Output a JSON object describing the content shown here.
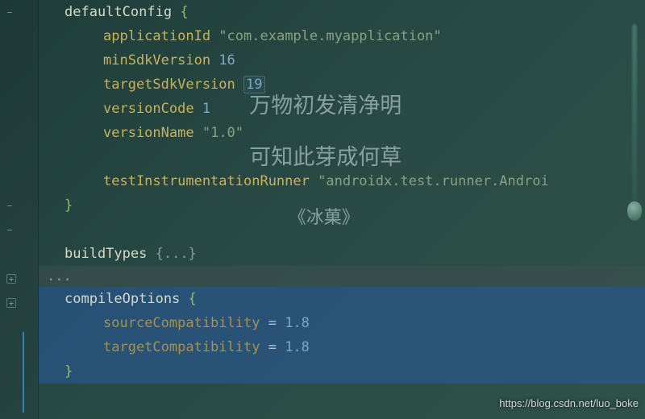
{
  "code": {
    "defaultConfig_kw": "defaultConfig",
    "applicationId_prop": "applicationId",
    "applicationId_val": "\"com.example.myapplication\"",
    "minSdk_prop": "minSdkVersion",
    "minSdk_val": "16",
    "targetSdk_prop": "targetSdkVersion",
    "targetSdk_val": "19",
    "versionCode_prop": "versionCode",
    "versionCode_val": "1",
    "versionName_prop": "versionName",
    "versionName_val": "\"1.0\"",
    "testRunner_prop": "testInstrumentationRunner",
    "testRunner_val": "\"androidx.test.runner.Androi",
    "buildTypes_kw": "buildTypes",
    "compileOptions_kw": "compileOptions",
    "sourceCompat_prop": "sourceCompatibility",
    "targetCompat_prop": "targetCompatibility",
    "compat_val": "1.8",
    "eq": " = ",
    "brace_open": "{",
    "brace_close": "}",
    "fold_block": "{...}",
    "ellipsis": "..."
  },
  "overlay": {
    "line1": "万物初发清净明",
    "line2": "可知此芽成何草",
    "line3": "《冰菓》"
  },
  "watermark": "https://blog.csdn.net/luo_boke"
}
